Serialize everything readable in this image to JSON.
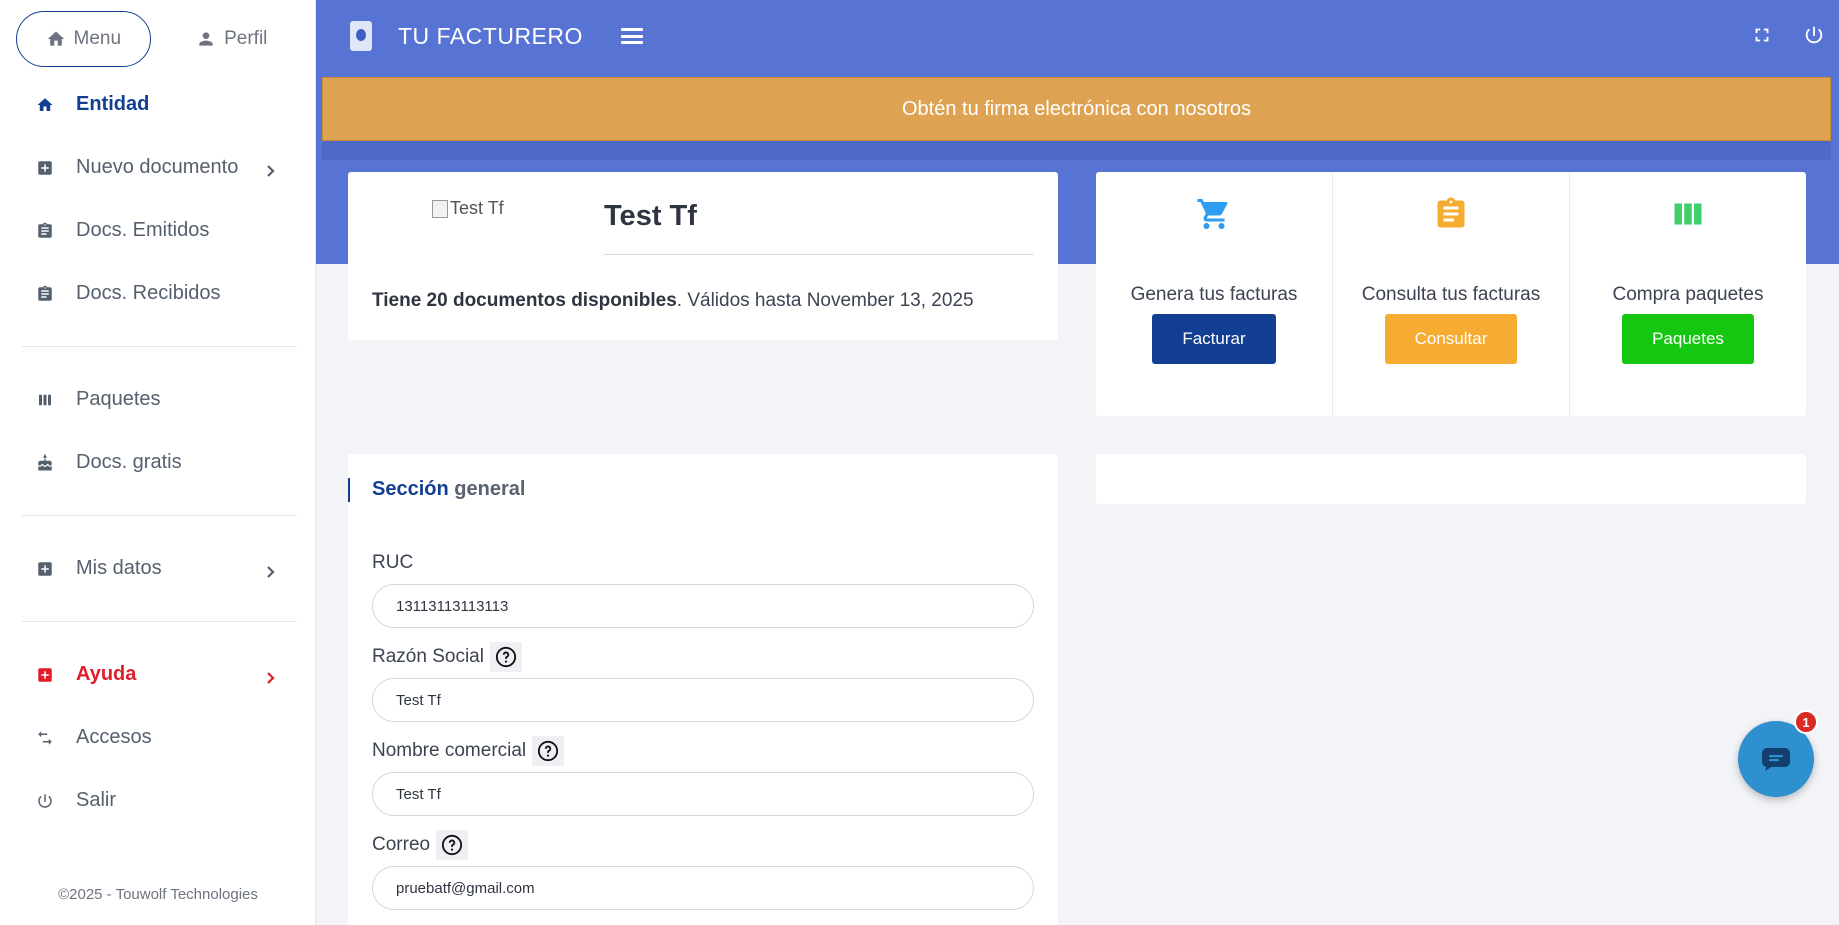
{
  "sidebar": {
    "tabs": [
      {
        "label": "Menu",
        "icon": "home-icon"
      },
      {
        "label": "Perfil",
        "icon": "person-icon"
      }
    ],
    "items": [
      {
        "label": "Entidad",
        "icon": "home-icon"
      },
      {
        "label": "Nuevo documento",
        "icon": "plus-box-icon"
      },
      {
        "label": "Docs. Emitidos",
        "icon": "clipboard-icon"
      },
      {
        "label": "Docs. Recibidos",
        "icon": "clipboard-icon"
      },
      {
        "label": "Paquetes",
        "icon": "columns-icon"
      },
      {
        "label": "Docs. gratis",
        "icon": "cake-icon"
      },
      {
        "label": "Mis datos",
        "icon": "plus-box-icon"
      },
      {
        "label": "Ayuda",
        "icon": "plus-box-icon"
      },
      {
        "label": "Accesos",
        "icon": "swap-icon"
      },
      {
        "label": "Salir",
        "icon": "power-icon"
      }
    ],
    "copyright": "©2025 - Touwolf Technologies"
  },
  "topbar": {
    "brand": "TU FACTURERO",
    "icons": [
      "menu-icon",
      "fullscreen-icon",
      "power-icon"
    ]
  },
  "banner": {
    "text": "Obtén tu firma electrónica con nosotros",
    "color": "#dea352"
  },
  "entity": {
    "image_alt": "Test Tf",
    "name": "Test Tf",
    "docs_bold": "Tiene 20 documentos disponibles",
    "docs_rest": ". Válidos hasta November 13, 2025"
  },
  "actions": [
    {
      "title": "Genera tus facturas",
      "button": "Facturar",
      "icon": "cart-icon",
      "color": "#123f92"
    },
    {
      "title": "Consulta tus facturas",
      "button": "Consultar",
      "icon": "clipboard-icon",
      "color": "#f6ab31"
    },
    {
      "title": "Compra paquetes",
      "button": "Paquetes",
      "icon": "columns-icon",
      "color": "#16c712"
    }
  ],
  "form": {
    "section_bold": "Sección",
    "section_rest": " general",
    "fields": [
      {
        "label": "RUC",
        "value": "13113113113113"
      },
      {
        "label": "Razón Social",
        "value": "Test Tf"
      },
      {
        "label": "Nombre comercial",
        "value": "Test Tf"
      },
      {
        "label": "Correo",
        "value": "pruebatf@gmail.com"
      }
    ]
  },
  "chat": {
    "badge": "1"
  },
  "colors": {
    "topbar": "#5773d4",
    "primary": "#123f92",
    "help": "#e11d2a"
  }
}
